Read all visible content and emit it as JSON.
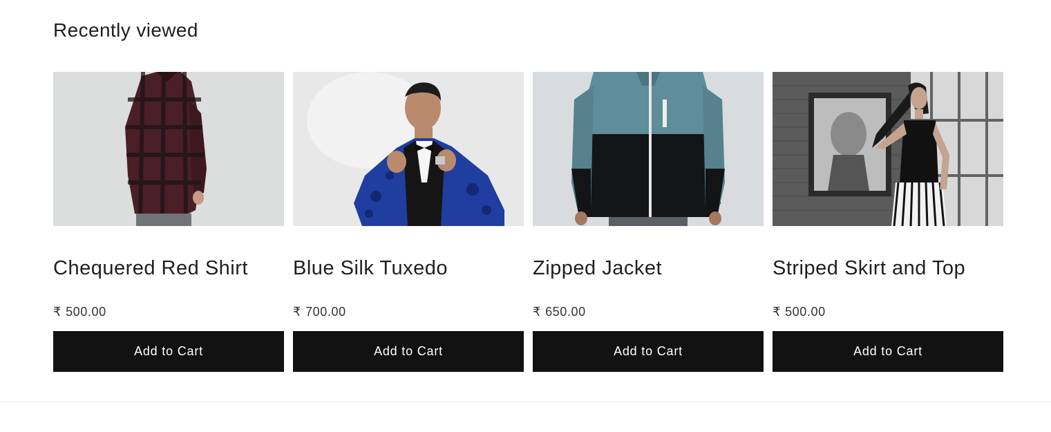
{
  "section": {
    "title": "Recently viewed"
  },
  "products": [
    {
      "title": "Chequered Red Shirt",
      "currency": "₹",
      "price": "500.00",
      "button_label": "Add to Cart",
      "image_desc": "man in chequered red shirt",
      "colors": {
        "bg": "#d9dbdb",
        "garment": "#4a1e26",
        "accent": "#1e1a1c"
      }
    },
    {
      "title": "Blue Silk Tuxedo",
      "currency": "₹",
      "price": "700.00",
      "button_label": "Add to Cart",
      "image_desc": "man in blue silk tuxedo",
      "colors": {
        "bg": "#e9e9e9",
        "garment": "#1f3ea0",
        "accent": "#0f1420"
      }
    },
    {
      "title": "Zipped Jacket",
      "currency": "₹",
      "price": "650.00",
      "button_label": "Add to Cart",
      "image_desc": "person in zipped jacket",
      "colors": {
        "bg": "#d7dbdd",
        "garment": "#5f8d9a",
        "accent": "#121416"
      }
    },
    {
      "title": "Striped Skirt and Top",
      "currency": "₹",
      "price": "500.00",
      "button_label": "Add to Cart",
      "image_desc": "woman in striped skirt and black top",
      "colors": {
        "bg": "#8a8a8a",
        "garment": "#111111",
        "accent": "#f2f2f2"
      }
    }
  ]
}
